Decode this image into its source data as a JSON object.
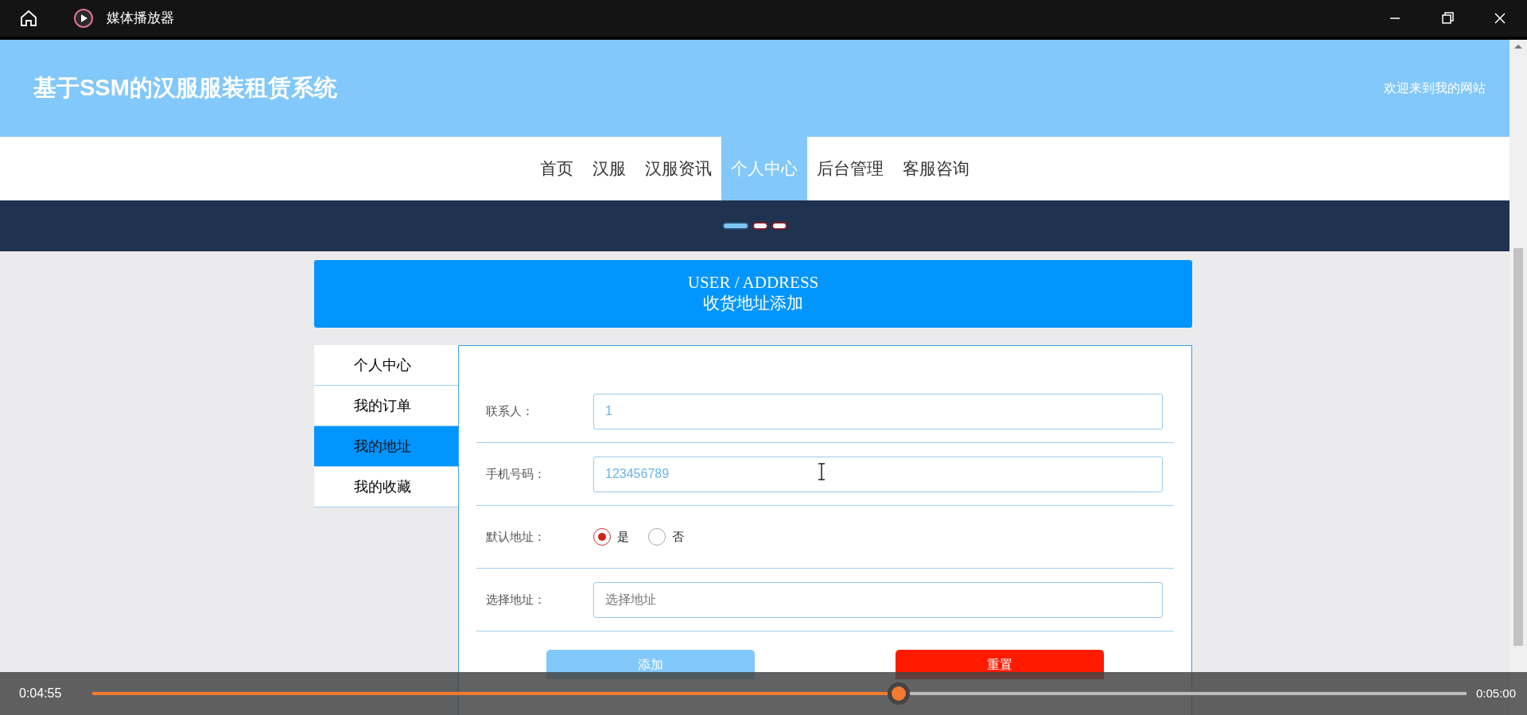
{
  "player": {
    "title": "媒体播放器",
    "current_time": "0:04:55",
    "total_time": "0:05:00",
    "level": 0.587
  },
  "site": {
    "title": "基于SSM的汉服服装租赁系统",
    "welcome": "欢迎来到我的网站"
  },
  "nav": [
    {
      "label": "首页",
      "selected": false
    },
    {
      "label": "汉服",
      "selected": false
    },
    {
      "label": "汉服资讯",
      "selected": false
    },
    {
      "label": "个人中心",
      "selected": true
    },
    {
      "label": "后台管理",
      "selected": false
    },
    {
      "label": "客服咨询",
      "selected": false
    }
  ],
  "banner": {
    "dots": [
      {
        "selected": true
      },
      {
        "selected": false
      },
      {
        "selected": false
      }
    ]
  },
  "page_header": {
    "title": "USER / ADDRESS",
    "subtitle": "收货地址添加"
  },
  "sidebar": [
    {
      "label": "个人中心",
      "selected": false
    },
    {
      "label": "我的订单",
      "selected": false
    },
    {
      "label": "我的地址",
      "selected": true
    },
    {
      "label": "我的收藏",
      "selected": false
    }
  ],
  "form": {
    "fields": [
      {
        "kind": "text",
        "label": "联系人：",
        "value": "1"
      },
      {
        "kind": "text",
        "label": "手机号码：",
        "value": "123456789"
      },
      {
        "kind": "radio",
        "label": "默认地址：",
        "options": [
          {
            "label": "是",
            "selected": true
          },
          {
            "label": "否",
            "selected": false
          }
        ]
      },
      {
        "kind": "text",
        "label": "选择地址：",
        "placeholder": "选择地址"
      }
    ],
    "buttons": [
      {
        "label": "添加",
        "kind": "primary"
      },
      {
        "label": "重置",
        "kind": "danger"
      }
    ]
  }
}
